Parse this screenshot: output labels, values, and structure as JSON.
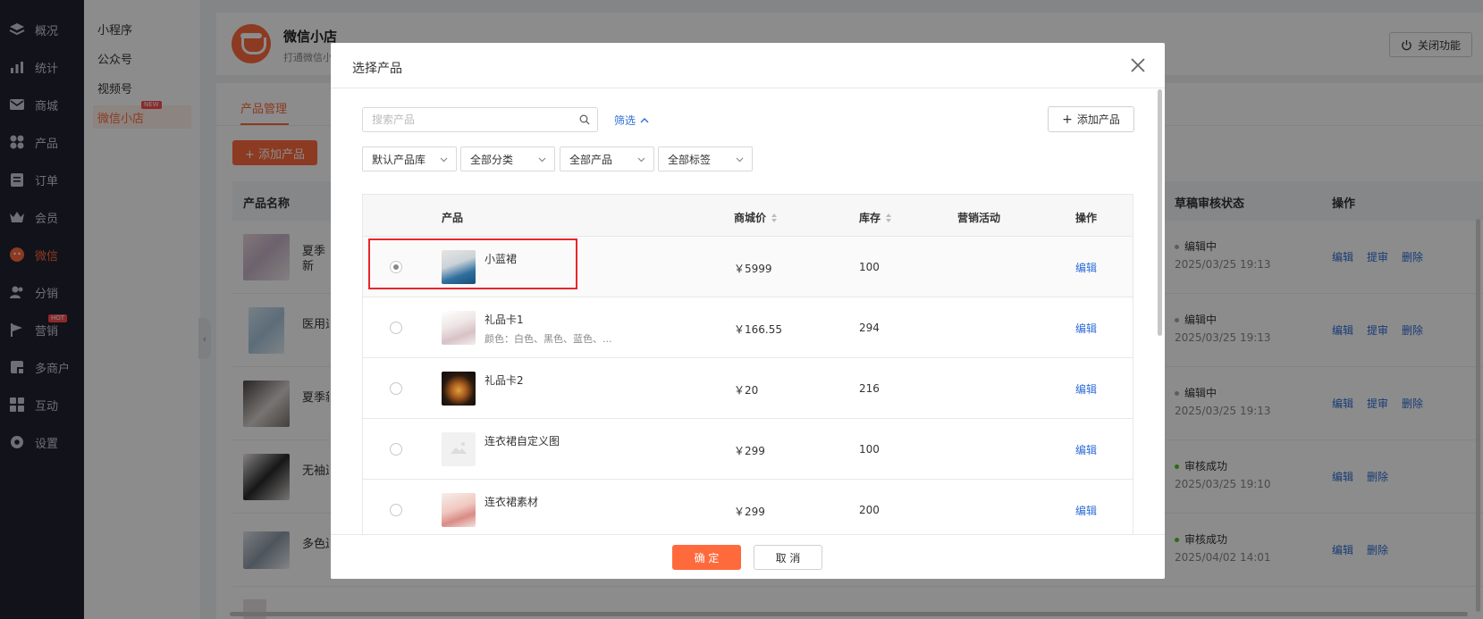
{
  "nav": {
    "items": [
      {
        "label": "概况",
        "icon": "layers-icon"
      },
      {
        "label": "统计",
        "icon": "chart-icon"
      },
      {
        "label": "商城",
        "icon": "mail-icon"
      },
      {
        "label": "产品",
        "icon": "grid-icon"
      },
      {
        "label": "订单",
        "icon": "order-icon"
      },
      {
        "label": "会员",
        "icon": "crown-icon"
      },
      {
        "label": "微信",
        "icon": "wechat-icon"
      },
      {
        "label": "分销",
        "icon": "users-icon"
      },
      {
        "label": "营销",
        "icon": "flag-icon",
        "badge": "HOT"
      },
      {
        "label": "多商户",
        "icon": "shop-icon"
      },
      {
        "label": "互动",
        "icon": "apps-icon"
      },
      {
        "label": "设置",
        "icon": "gear-icon"
      }
    ],
    "active": "微信"
  },
  "subnav": {
    "items": [
      "小程序",
      "公众号",
      "视频号",
      "微信小店"
    ],
    "active": "微信小店",
    "new_badge": "NEW"
  },
  "header": {
    "shop_name": "微信小店 __",
    "shop_desc": "打通微信小",
    "close_button": "关闭功能"
  },
  "page": {
    "tab": "产品管理",
    "add_button": "+ 添加产品",
    "columns": {
      "name": "产品名称",
      "status": "草稿审核状态",
      "ops": "操作"
    },
    "rows": [
      {
        "name": "夏季新 名媛风",
        "status": "编辑中",
        "time": "2025/03/25 19:13",
        "ops": [
          "编辑",
          "提审",
          "删除"
        ]
      },
      {
        "name": "医用退",
        "status": "编辑中",
        "time": "2025/03/25 19:13",
        "ops": [
          "编辑",
          "提审",
          "删除"
        ]
      },
      {
        "name": "夏季新",
        "status": "编辑中",
        "time": "2025/03/25 19:13",
        "ops": [
          "编辑",
          "提审",
          "删除"
        ]
      },
      {
        "name": "无袖连",
        "status": "审核成功",
        "time": "2025/03/25 19:10",
        "ops": [
          "编辑",
          "删除"
        ]
      },
      {
        "name": "多色连",
        "status": "审核成功",
        "time": "2025/04/02 14:01",
        "ops": [
          "编辑",
          "删除"
        ]
      }
    ],
    "status_colors": {
      "编辑中": "#aaaaaa",
      "审核成功": "#52c41a"
    }
  },
  "modal": {
    "title": "选择产品",
    "search_placeholder": "搜索产品",
    "filter_label": "筛选",
    "add_product": "添加产品",
    "selects": [
      "默认产品库",
      "全部分类",
      "全部产品",
      "全部标签"
    ],
    "columns": {
      "product": "产品",
      "price": "商城价",
      "stock": "库存",
      "activity": "营销活动",
      "ops": "操作"
    },
    "rows": [
      {
        "name": "小蓝裙",
        "spec": "",
        "price": "￥5999",
        "stock": "100",
        "edit": "编辑",
        "selected": true
      },
      {
        "name": "礼品卡1",
        "spec": "颜色：白色、黑色、蓝色、...",
        "price": "￥166.55",
        "stock": "294",
        "edit": "编辑",
        "selected": false
      },
      {
        "name": "礼品卡2",
        "spec": "",
        "price": "￥20",
        "stock": "216",
        "edit": "编辑",
        "selected": false
      },
      {
        "name": "连衣裙自定义图",
        "spec": "",
        "price": "￥299",
        "stock": "100",
        "edit": "编辑",
        "selected": false
      },
      {
        "name": "连衣裙素材",
        "spec": "",
        "price": "￥299",
        "stock": "200",
        "edit": "编辑",
        "selected": false
      }
    ],
    "confirm": "确 定",
    "cancel": "取 消"
  },
  "colors": {
    "accent": "#ff6a3d",
    "link": "#2d6cd8",
    "sidebar": "#1f2230",
    "highlight": "#e8262d"
  }
}
